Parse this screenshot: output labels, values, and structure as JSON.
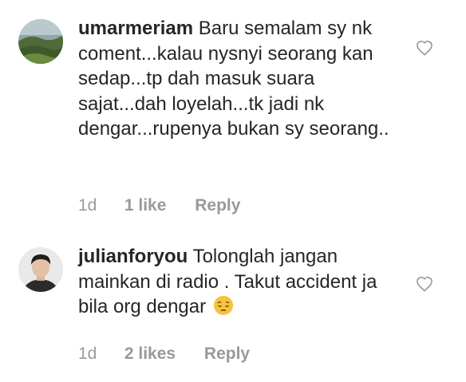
{
  "comments": [
    {
      "username": "umarmeriam",
      "text": "Baru semalam sy nk coment...kalau nysnyi seorang kan sedap...tp dah masuk suara sajat...dah loyelah...tk jadi nk dengar...rupenya bukan sy seorang..",
      "emoji_icon": "",
      "time": "1d",
      "likes": "1 like",
      "reply": "Reply"
    },
    {
      "username": "julianforyou",
      "text": "Tolonglah jangan mainkan di radio . Takut accident ja bila org dengar",
      "emoji_icon": "pensive-face-emoji",
      "time": "1d",
      "likes": "2 likes",
      "reply": "Reply"
    }
  ],
  "colors": {
    "text": "#262626",
    "meta": "#9a9a9a",
    "heart_outline": "#8e8e8e",
    "emoji_yellow": "#f7c23c"
  }
}
